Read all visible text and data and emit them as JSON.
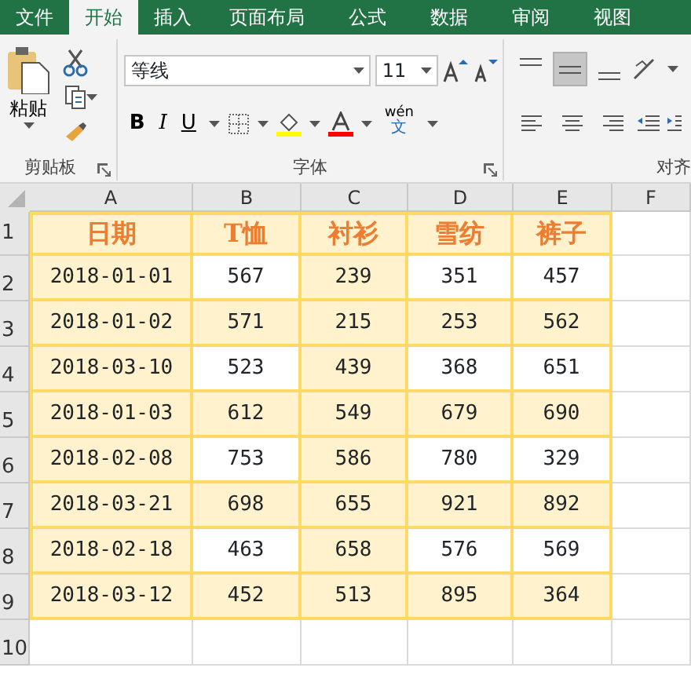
{
  "tabs": [
    {
      "label": "文件",
      "selected": false
    },
    {
      "label": "开始",
      "selected": true
    },
    {
      "label": "插入",
      "selected": false
    },
    {
      "label": "页面布局",
      "selected": false
    },
    {
      "label": "公式",
      "selected": false
    },
    {
      "label": "数据",
      "selected": false
    },
    {
      "label": "审阅",
      "selected": false
    },
    {
      "label": "视图",
      "selected": false
    }
  ],
  "clipboard": {
    "paste_label": "粘贴",
    "group_label": "剪贴板"
  },
  "font": {
    "font_name": "等线",
    "font_size": "11",
    "bold": "B",
    "italic": "I",
    "underline": "U",
    "phonetic_top": "wén",
    "phonetic_bottom": "文",
    "group_label": "字体"
  },
  "alignment": {
    "group_label": "对齐",
    "buttons": [
      {
        "kind": "top",
        "selected": false
      },
      {
        "kind": "middle",
        "selected": true
      },
      {
        "kind": "bottom",
        "selected": false
      }
    ],
    "buttons_row2": [
      {
        "kind": "left",
        "selected": false
      },
      {
        "kind": "center",
        "selected": false
      },
      {
        "kind": "right",
        "selected": false
      }
    ]
  },
  "sheet": {
    "columns": [
      "A",
      "B",
      "C",
      "D",
      "E",
      "F"
    ],
    "rows": [
      {
        "number": "1",
        "kind": "header",
        "cells": [
          {
            "text": "日期",
            "highlighted": true
          },
          {
            "text": "T恤",
            "highlighted": true
          },
          {
            "text": "衬衫",
            "highlighted": true
          },
          {
            "text": "雪纺",
            "highlighted": true
          },
          {
            "text": "裤子",
            "highlighted": true
          }
        ]
      },
      {
        "number": "2",
        "kind": "data",
        "cells": [
          {
            "text": "2018-01-01",
            "highlighted": true
          },
          {
            "text": "567",
            "highlighted": false
          },
          {
            "text": "239",
            "highlighted": true
          },
          {
            "text": "351",
            "highlighted": false
          },
          {
            "text": "457",
            "highlighted": false
          }
        ]
      },
      {
        "number": "3",
        "kind": "data",
        "cells": [
          {
            "text": "2018-01-02",
            "highlighted": true
          },
          {
            "text": "571",
            "highlighted": true
          },
          {
            "text": "215",
            "highlighted": true
          },
          {
            "text": "253",
            "highlighted": true
          },
          {
            "text": "562",
            "highlighted": true
          }
        ]
      },
      {
        "number": "4",
        "kind": "data",
        "cells": [
          {
            "text": "2018-03-10",
            "highlighted": true
          },
          {
            "text": "523",
            "highlighted": false
          },
          {
            "text": "439",
            "highlighted": true
          },
          {
            "text": "368",
            "highlighted": false
          },
          {
            "text": "651",
            "highlighted": false
          }
        ]
      },
      {
        "number": "5",
        "kind": "data",
        "cells": [
          {
            "text": "2018-01-03",
            "highlighted": true
          },
          {
            "text": "612",
            "highlighted": true
          },
          {
            "text": "549",
            "highlighted": true
          },
          {
            "text": "679",
            "highlighted": true
          },
          {
            "text": "690",
            "highlighted": true
          }
        ]
      },
      {
        "number": "6",
        "kind": "data",
        "cells": [
          {
            "text": "2018-02-08",
            "highlighted": true
          },
          {
            "text": "753",
            "highlighted": false
          },
          {
            "text": "586",
            "highlighted": true
          },
          {
            "text": "780",
            "highlighted": false
          },
          {
            "text": "329",
            "highlighted": false
          }
        ]
      },
      {
        "number": "7",
        "kind": "data",
        "cells": [
          {
            "text": "2018-03-21",
            "highlighted": true
          },
          {
            "text": "698",
            "highlighted": true
          },
          {
            "text": "655",
            "highlighted": true
          },
          {
            "text": "921",
            "highlighted": true
          },
          {
            "text": "892",
            "highlighted": true
          }
        ]
      },
      {
        "number": "8",
        "kind": "data",
        "cells": [
          {
            "text": "2018-02-18",
            "highlighted": true
          },
          {
            "text": "463",
            "highlighted": false
          },
          {
            "text": "658",
            "highlighted": true
          },
          {
            "text": "576",
            "highlighted": false
          },
          {
            "text": "569",
            "highlighted": false
          }
        ]
      },
      {
        "number": "9",
        "kind": "data",
        "cells": [
          {
            "text": "2018-03-12",
            "highlighted": true
          },
          {
            "text": "452",
            "highlighted": true
          },
          {
            "text": "513",
            "highlighted": true
          },
          {
            "text": "895",
            "highlighted": true
          },
          {
            "text": "364",
            "highlighted": true
          }
        ]
      },
      {
        "number": "10",
        "kind": "data",
        "cells": []
      }
    ]
  }
}
